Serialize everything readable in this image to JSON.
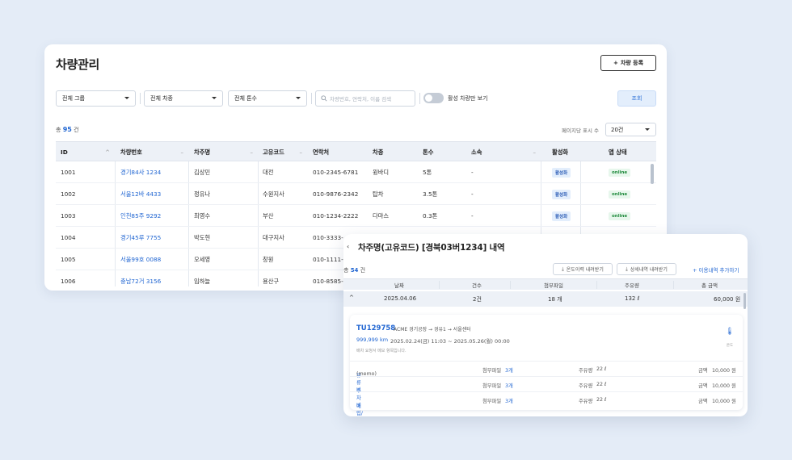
{
  "page": {
    "title": "차량관리",
    "register_label": "차량 등록",
    "filters": {
      "group": "전체 그룹",
      "type": "전체 차종",
      "tonnage": "전체 톤수",
      "search_placeholder": "차량번호, 연락처, 이름 검색",
      "toggle_label": "활성 차량만 보기",
      "query_label": "조회"
    },
    "total_prefix": "총",
    "total_count": "95",
    "total_suffix": "건",
    "per_page_label": "페이지당 표시 수",
    "per_page_value": "20건"
  },
  "table": {
    "headers": [
      "ID",
      "차량번호",
      "차주명",
      "고유코드",
      "연락처",
      "차종",
      "톤수",
      "소속",
      "활성화",
      "앱 상태"
    ],
    "rows": [
      {
        "id": "1001",
        "plate": "경기84사 1234",
        "owner": "김상민",
        "code": "대전",
        "phone": "010-2345-6781",
        "vtype": "윙바디",
        "ton": "5톤",
        "org": "-",
        "active": "활성화",
        "app": "online"
      },
      {
        "id": "1002",
        "plate": "서울12바 4433",
        "owner": "정유나",
        "code": "수원지사",
        "phone": "010-9876-2342",
        "vtype": "탑차",
        "ton": "3.5톤",
        "org": "-",
        "active": "활성화",
        "app": "online"
      },
      {
        "id": "1003",
        "plate": "인천85주 9292",
        "owner": "최영수",
        "code": "부산",
        "phone": "010-1234-2222",
        "vtype": "다마스",
        "ton": "0.3톤",
        "org": "-",
        "active": "활성화",
        "app": "online"
      },
      {
        "id": "1004",
        "plate": "경기45루 7755",
        "owner": "박도현",
        "code": "대구지사",
        "phone": "010-3333-",
        "vtype": "",
        "ton": "",
        "org": "",
        "active": "",
        "app": ""
      },
      {
        "id": "1005",
        "plate": "서울99호 0088",
        "owner": "오세영",
        "code": "창원",
        "phone": "010-1111-5",
        "vtype": "",
        "ton": "",
        "org": "",
        "active": "",
        "app": ""
      },
      {
        "id": "1006",
        "plate": "충남72거 3156",
        "owner": "임하늘",
        "code": "용산구",
        "phone": "010-8585-",
        "vtype": "",
        "ton": "",
        "org": "",
        "active": "",
        "app": ""
      }
    ]
  },
  "detail": {
    "title": "차주명(고유코드) [경북03버1234] 내역",
    "count_prefix": "총",
    "count": "54",
    "count_suffix": "건",
    "download_temp_label": "온도이력 내려받기",
    "download_detail_label": "상세내역 내려받기",
    "add_usage_label": "+ 이용내역 추가하기",
    "headers": [
      "날짜",
      "건수",
      "첨부파일",
      "주유량",
      "총 금액"
    ],
    "summary": {
      "date": "2025.04.06",
      "count": "2건",
      "files": "18 개",
      "fuel": "132 ℓ",
      "amount": "60,000 원"
    },
    "trip": {
      "id": "TU129758",
      "route": "ACME 경기공장 → 경유1 → 서울센터",
      "km": "999,999 km",
      "time": "2025.02.24(금) 11:03 ~ 2025.05.26(월) 00:00",
      "note": "배차 요청서 메모 항목입니다.",
      "temp_label": "온도"
    },
    "items": [
      {
        "name": "유류비",
        "memo": "(memo)",
        "files_label": "첨부파일",
        "files": "3개",
        "fuel_label": "주유량",
        "fuel": "22 ℓ",
        "amount_label": "금액",
        "amount": "10,000 원"
      },
      {
        "name": "주차비",
        "memo": "",
        "files_label": "첨부파일",
        "files": "3개",
        "fuel_label": "주유량",
        "fuel": "22 ℓ",
        "amount_label": "금액",
        "amount": "10,000 원"
      },
      {
        "name": "매입/매출증명서",
        "memo": "",
        "files_label": "첨부파일",
        "files": "3개",
        "fuel_label": "주유량",
        "fuel": "22 ℓ",
        "amount_label": "금액",
        "amount": "10,000 원"
      }
    ]
  }
}
